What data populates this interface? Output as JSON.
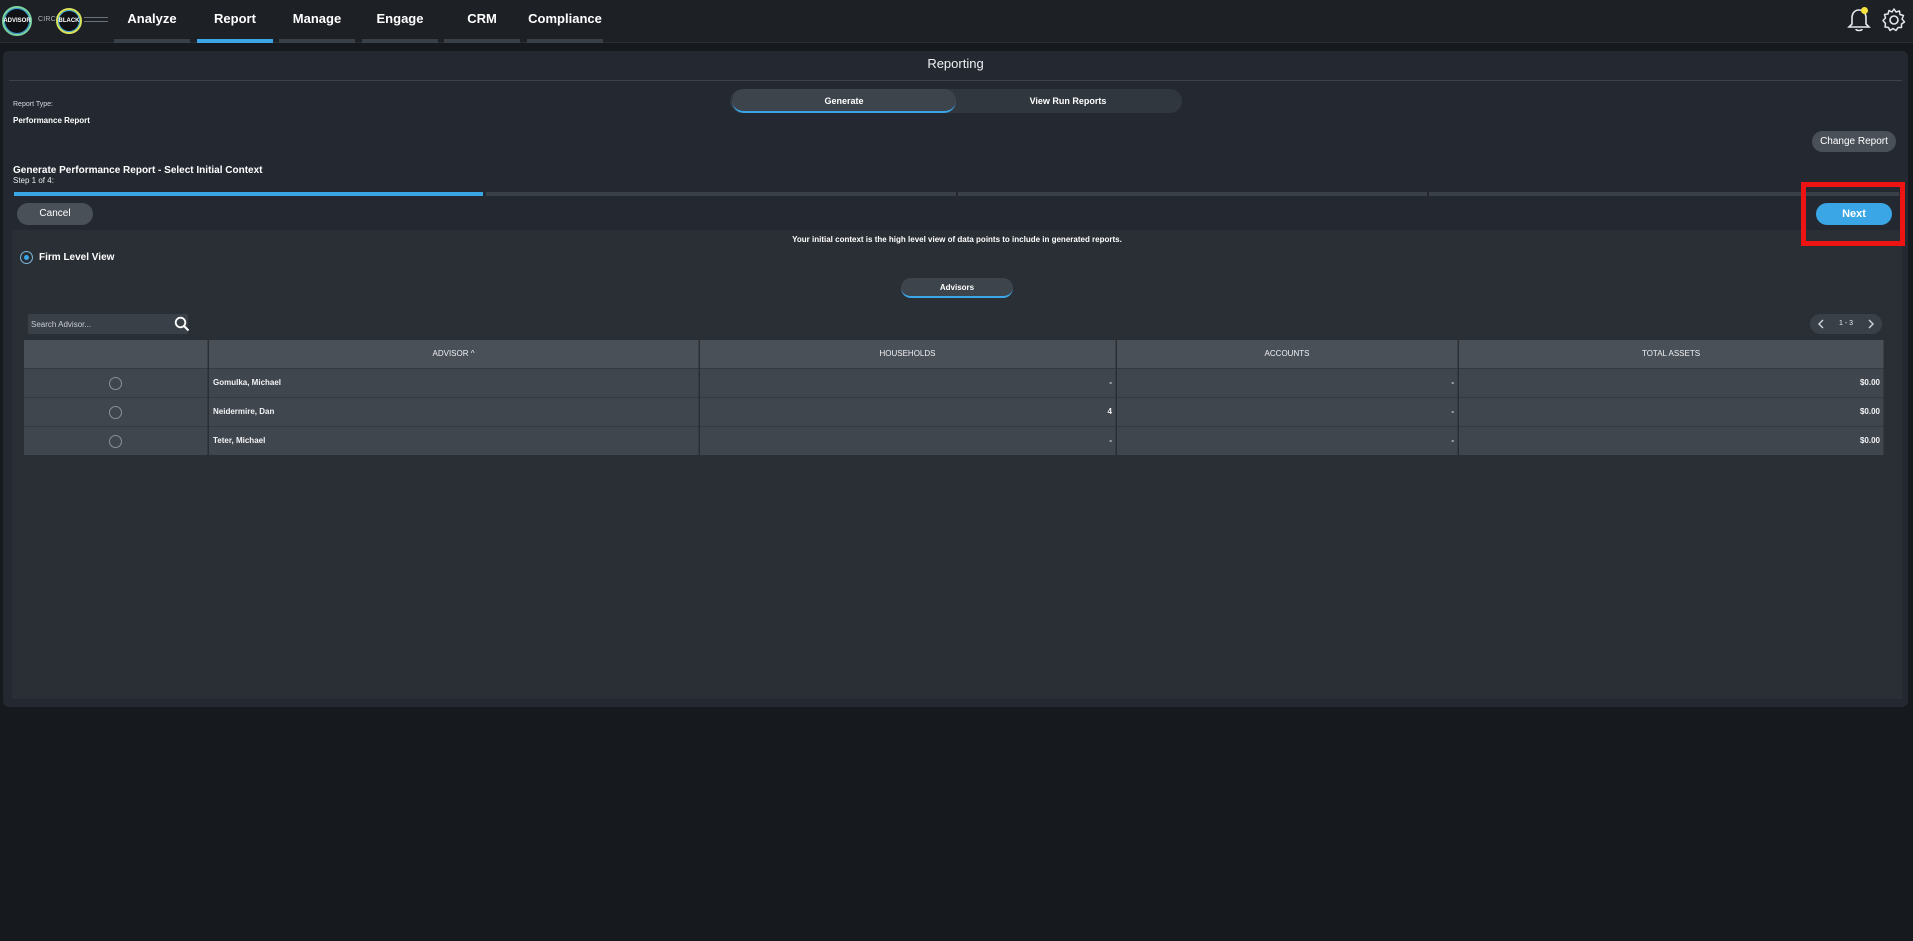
{
  "nav": {
    "logo_text": "ADVISOR",
    "logo_partner": "CIRCLE",
    "logo_partner2": "BLACK",
    "items": [
      {
        "label": "Analyze"
      },
      {
        "label": "Report"
      },
      {
        "label": "Manage"
      },
      {
        "label": "Engage"
      },
      {
        "label": "CRM"
      },
      {
        "label": "Compliance"
      }
    ],
    "active": "Report",
    "icons": [
      "bell-icon",
      "gear-icon"
    ],
    "notification_color": "#f5e23a"
  },
  "page": {
    "title": "Reporting",
    "tabs": {
      "generate": "Generate",
      "view_run": "View Run Reports"
    },
    "report_type_label": "Report Type:",
    "report_type_value": "Performance Report",
    "change_report": "Change Report",
    "heading": "Generate Performance Report - Select Initial Context",
    "step": "Step 1 of 4:",
    "progress": {
      "current_step": 1,
      "total_steps": 4
    },
    "cancel": "Cancel",
    "next": "Next",
    "context_note": "Your initial context is the high level view of data points to include in generated reports.",
    "firm_level": "Firm Level View",
    "advisors_tab": "Advisors",
    "accent_color": "#3aa6e6"
  },
  "search": {
    "placeholder": "Search Advisor..."
  },
  "pager": {
    "text": "1 - 3"
  },
  "table": {
    "columns": [
      "ADVISOR ^",
      "HOUSEHOLDS",
      "ACCOUNTS",
      "TOTAL ASSETS"
    ],
    "rows": [
      {
        "advisor": "Gomulka, Michael",
        "households": "-",
        "accounts": "-",
        "total_assets": "$0.00"
      },
      {
        "advisor": "Neidermire, Dan",
        "households": "4",
        "accounts": "-",
        "total_assets": "$0.00"
      },
      {
        "advisor": "Teter, Michael",
        "households": "-",
        "accounts": "-",
        "total_assets": "$0.00"
      }
    ]
  }
}
